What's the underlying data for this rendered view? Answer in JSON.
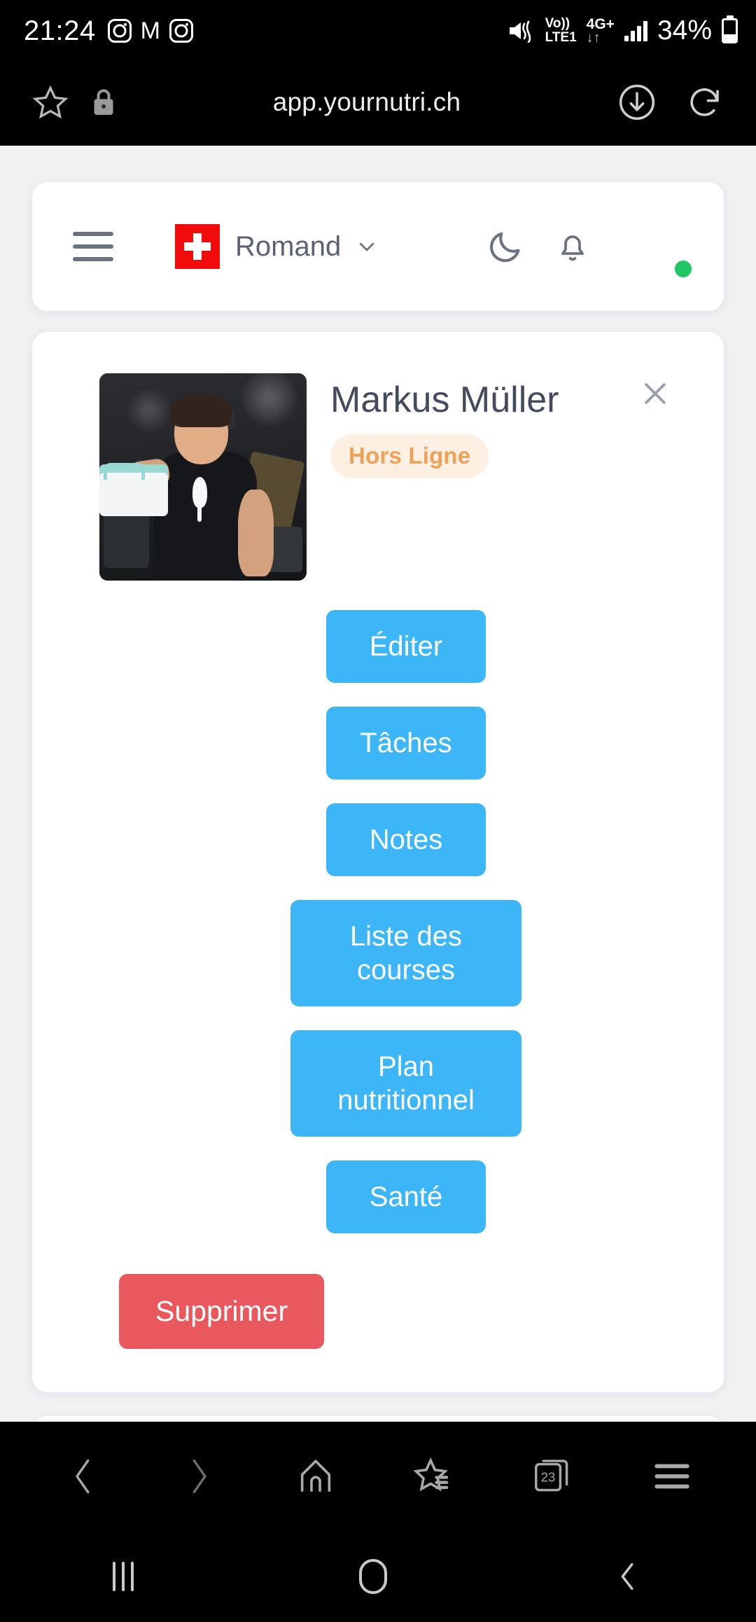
{
  "status_bar": {
    "clock": "21:24",
    "left_app_icons": [
      "instagram-icon",
      "gmail-icon",
      "instagram-icon"
    ],
    "gmail_glyph": "M",
    "mute_icon": "volume-mute-icon",
    "volte_line1": "Vo))",
    "volte_line2": "LTE1",
    "network_type": "4G+",
    "data_arrows": "↓↑",
    "signal_icon": "signal-bars-icon",
    "battery_percent": "34%",
    "battery_icon": "battery-icon"
  },
  "browser": {
    "url": "app.yournutri.ch",
    "bookmark_icon": "star-outline-icon",
    "secure_icon": "lock-icon",
    "download_icon": "download-circle-icon",
    "reload_icon": "reload-icon",
    "toolbar": {
      "back": "back-arrow-icon",
      "forward": "forward-arrow-icon",
      "home": "home-icon",
      "bookmarks": "star-list-icon",
      "tabs_count": "23",
      "menu": "hamburger-menu-icon"
    }
  },
  "app_header": {
    "menu_icon": "hamburger-menu-icon",
    "flag": "swiss-flag-icon",
    "language": "Romand",
    "language_chevron": "chevron-down-icon",
    "dark_mode_icon": "moon-icon",
    "notifications_icon": "bell-icon",
    "avatar": "user-avatar",
    "online_status": "online"
  },
  "client_card": {
    "photo_alt": "client-photo",
    "name": "Markus Müller",
    "status_badge": "Hors Ligne",
    "close_icon": "close-icon",
    "actions": [
      {
        "label": "Éditer",
        "name": "edit-button"
      },
      {
        "label": "Tâches",
        "name": "tasks-button"
      },
      {
        "label": "Notes",
        "name": "notes-button"
      },
      {
        "label": "Liste des courses",
        "name": "shopping-list-button"
      },
      {
        "label": "Plan nutritionnel",
        "name": "nutrition-plan-button"
      },
      {
        "label": "Santé",
        "name": "health-button"
      }
    ],
    "delete_label": "Supprimer"
  },
  "android_nav": {
    "recents_icon": "recents-icon",
    "home_icon": "home-circle-icon",
    "back_icon": "back-chevron-icon"
  },
  "colors": {
    "accent_blue": "#3cb6f7",
    "danger_red": "#e8585d",
    "badge_text": "#efa157",
    "badge_bg": "#fdf0e2",
    "online_green": "#21c665",
    "page_bg": "#f0f1f3",
    "flag_red": "#f20b0b"
  }
}
